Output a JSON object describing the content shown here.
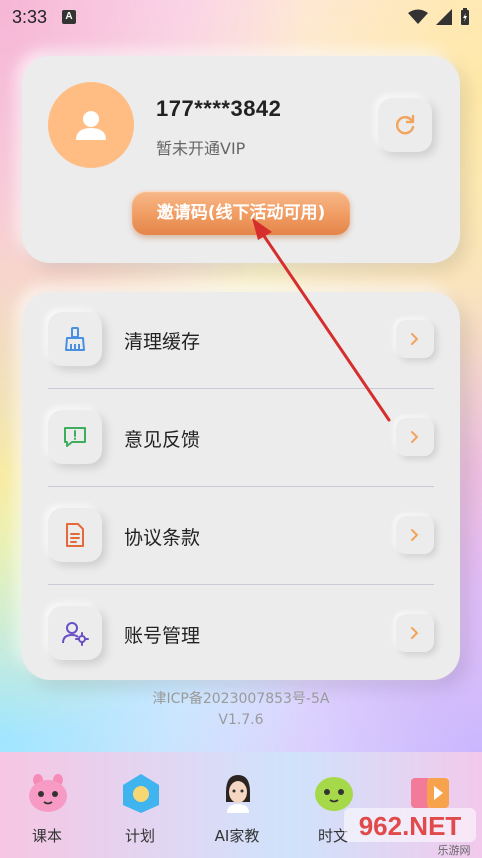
{
  "status_bar": {
    "time": "3:33",
    "notif_letter": "A"
  },
  "profile": {
    "phone": "177****3842",
    "vip_status": "暂未开通VIP",
    "invite_label": "邀请码(线下活动可用)"
  },
  "menu": {
    "items": [
      {
        "label": "清理缓存",
        "icon": "broom-icon"
      },
      {
        "label": "意见反馈",
        "icon": "feedback-icon"
      },
      {
        "label": "协议条款",
        "icon": "document-icon"
      },
      {
        "label": "账号管理",
        "icon": "user-settings-icon"
      }
    ]
  },
  "footer": {
    "icp": "津ICP备2023007853号-5A",
    "version": "V1.7.6"
  },
  "bottom_nav": {
    "items": [
      {
        "label": "课本"
      },
      {
        "label": "计划"
      },
      {
        "label": "AI家教"
      },
      {
        "label": "时文"
      },
      {
        "label": ""
      }
    ]
  },
  "watermark": {
    "text": "962.NET",
    "subtext": "乐游网"
  },
  "colors": {
    "accent_orange": "#f09c62",
    "avatar_bg": "#ffbd84",
    "annotation_red": "#d62d2d"
  }
}
